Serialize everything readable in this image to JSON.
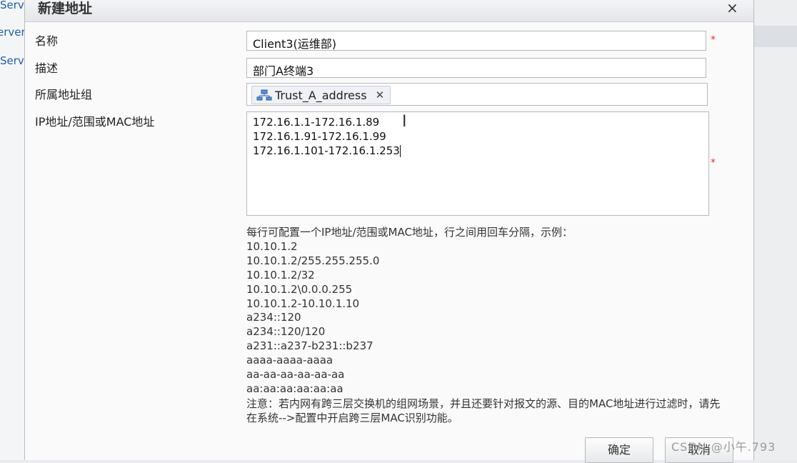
{
  "background": {
    "left_items": [
      "Serv",
      "erver",
      "Serv"
    ]
  },
  "dialog": {
    "title": "新建地址",
    "close_label": "×",
    "fields": {
      "name_label": "名称",
      "name_value": "Client3(运维部)",
      "desc_label": "描述",
      "desc_value": "部门A终端3",
      "group_label": "所属地址组",
      "group_tag": "Trust_A_address",
      "group_tag_icon": "network-group-icon",
      "ip_label": "IP地址/范围或MAC地址",
      "ip_lines": [
        "172.16.1.1-172.16.1.89",
        "172.16.1.91-172.16.1.99",
        "172.16.1.101-172.16.1.253"
      ],
      "required_mark": "*"
    },
    "help": {
      "intro": "每行可配置一个IP地址/范围或MAC地址，行之间用回车分隔，示例：",
      "examples": [
        "10.10.1.2",
        "10.10.1.2/255.255.255.0",
        "10.10.1.2/32",
        "10.10.1.2\\0.0.0.255",
        "10.10.1.2-10.10.1.10",
        "a234::120",
        "a234::120/120",
        "a231::a237-b231::b237",
        "aaaa-aaaa-aaaa",
        "aa-aa-aa-aa-aa-aa",
        "aa:aa:aa:aa:aa:aa"
      ],
      "note": "注意：若内网有跨三层交换机的组网场景，并且还要针对报文的源、目的MAC地址进行过滤时，请先在系统-->配置中开启跨三层MAC识别功能。"
    },
    "buttons": {
      "ok": "确定",
      "cancel": "取消"
    }
  },
  "watermark": "CSDN @小午.793",
  "colors": {
    "required": "#e2333a",
    "link": "#1f5fa8"
  }
}
